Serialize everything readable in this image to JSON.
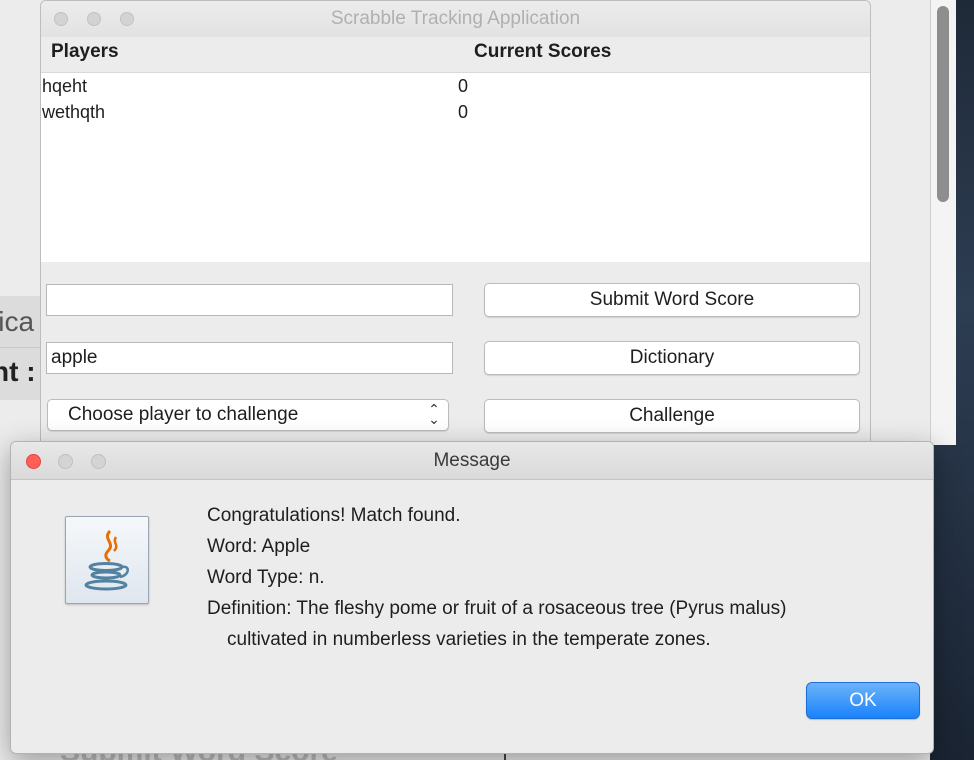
{
  "background": {
    "left_fragment_1": "lica",
    "left_fragment_2": "nt :",
    "bottom_fragment": "Submit Word Score"
  },
  "main_window": {
    "title": "Scrabble Tracking Application",
    "table": {
      "columns": [
        "Players",
        "Current Scores"
      ],
      "rows": [
        {
          "player": "hqeht",
          "score": "0"
        },
        {
          "player": "wethqth",
          "score": "0"
        }
      ]
    },
    "score_input": {
      "value": ""
    },
    "submit_button": "Submit Word Score",
    "word_input": {
      "value": "apple"
    },
    "dictionary_button": "Dictionary",
    "challenge_select": {
      "selected": "Choose player to challenge"
    },
    "challenge_button": "Challenge"
  },
  "dialog": {
    "title": "Message",
    "icon": "java-coffee-cup-icon",
    "lines": [
      "Congratulations! Match found.",
      "Word: Apple",
      "Word Type: n.",
      "Definition: The fleshy pome or fruit of a rosaceous tree (Pyrus malus)",
      "cultivated in numberless varieties in the temperate zones."
    ],
    "ok_button": "OK"
  },
  "colors": {
    "accent_blue": "#1a82fb",
    "close_red": "#ff5f57",
    "java_orange": "#e76f00",
    "java_blue": "#5382a1"
  }
}
